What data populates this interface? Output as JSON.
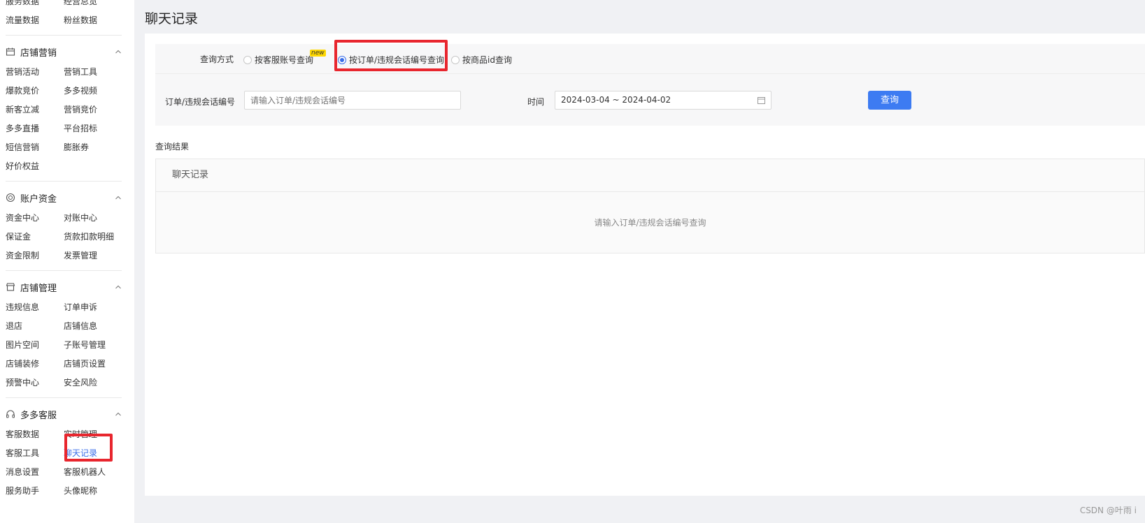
{
  "sidebar": {
    "top_rows": [
      [
        "服务数据",
        "经营总览"
      ],
      [
        "流量数据",
        "粉丝数据"
      ]
    ],
    "sections": [
      {
        "title": "店铺营销",
        "icon": "store-calendar-icon",
        "rows": [
          [
            "营销活动",
            "营销工具"
          ],
          [
            "爆款竞价",
            "多多视频"
          ],
          [
            "新客立减",
            "营销竞价"
          ],
          [
            "多多直播",
            "平台招标"
          ],
          [
            "短信营销",
            "膨胀券"
          ],
          [
            "好价权益",
            ""
          ]
        ]
      },
      {
        "title": "账户资金",
        "icon": "coin-icon",
        "rows": [
          [
            "资金中心",
            "对账中心"
          ],
          [
            "保证金",
            "货款扣款明细"
          ],
          [
            "资金限制",
            "发票管理"
          ]
        ]
      },
      {
        "title": "店铺管理",
        "icon": "shop-icon",
        "rows": [
          [
            "违规信息",
            "订单申诉"
          ],
          [
            "退店",
            "店铺信息"
          ],
          [
            "图片空间",
            "子账号管理"
          ],
          [
            "店铺装修",
            "店铺页设置"
          ],
          [
            "预警中心",
            "安全风险"
          ]
        ]
      },
      {
        "title": "多多客服",
        "icon": "headset-icon",
        "rows": [
          [
            "客服数据",
            "实时管理"
          ],
          [
            "客服工具",
            "聊天记录"
          ],
          [
            "消息设置",
            "客服机器人"
          ],
          [
            "服务助手",
            "头像昵称"
          ]
        ]
      }
    ],
    "active_item": "聊天记录"
  },
  "page": {
    "title": "聊天记录"
  },
  "query": {
    "method_label": "查询方式",
    "options": [
      {
        "label": "按客服账号查询",
        "badge": "new",
        "selected": false
      },
      {
        "label": "按订单/违规会话编号查询",
        "selected": true
      },
      {
        "label": "按商品id查询",
        "selected": false
      }
    ],
    "order_label": "订单/违规会话编号",
    "order_placeholder": "请输入订单/违规会话编号",
    "time_label": "时间",
    "date_range": "2024-03-04 ~ 2024-04-02",
    "search_button": "查询"
  },
  "results": {
    "label": "查询结果",
    "header": "聊天记录",
    "empty_text": "请输入订单/违规会话编号查询"
  },
  "watermark": "CSDN @叶雨 i",
  "colors": {
    "accent": "#3d7bf2",
    "highlight_box": "#e8262e",
    "new_badge": "#ffd800"
  }
}
